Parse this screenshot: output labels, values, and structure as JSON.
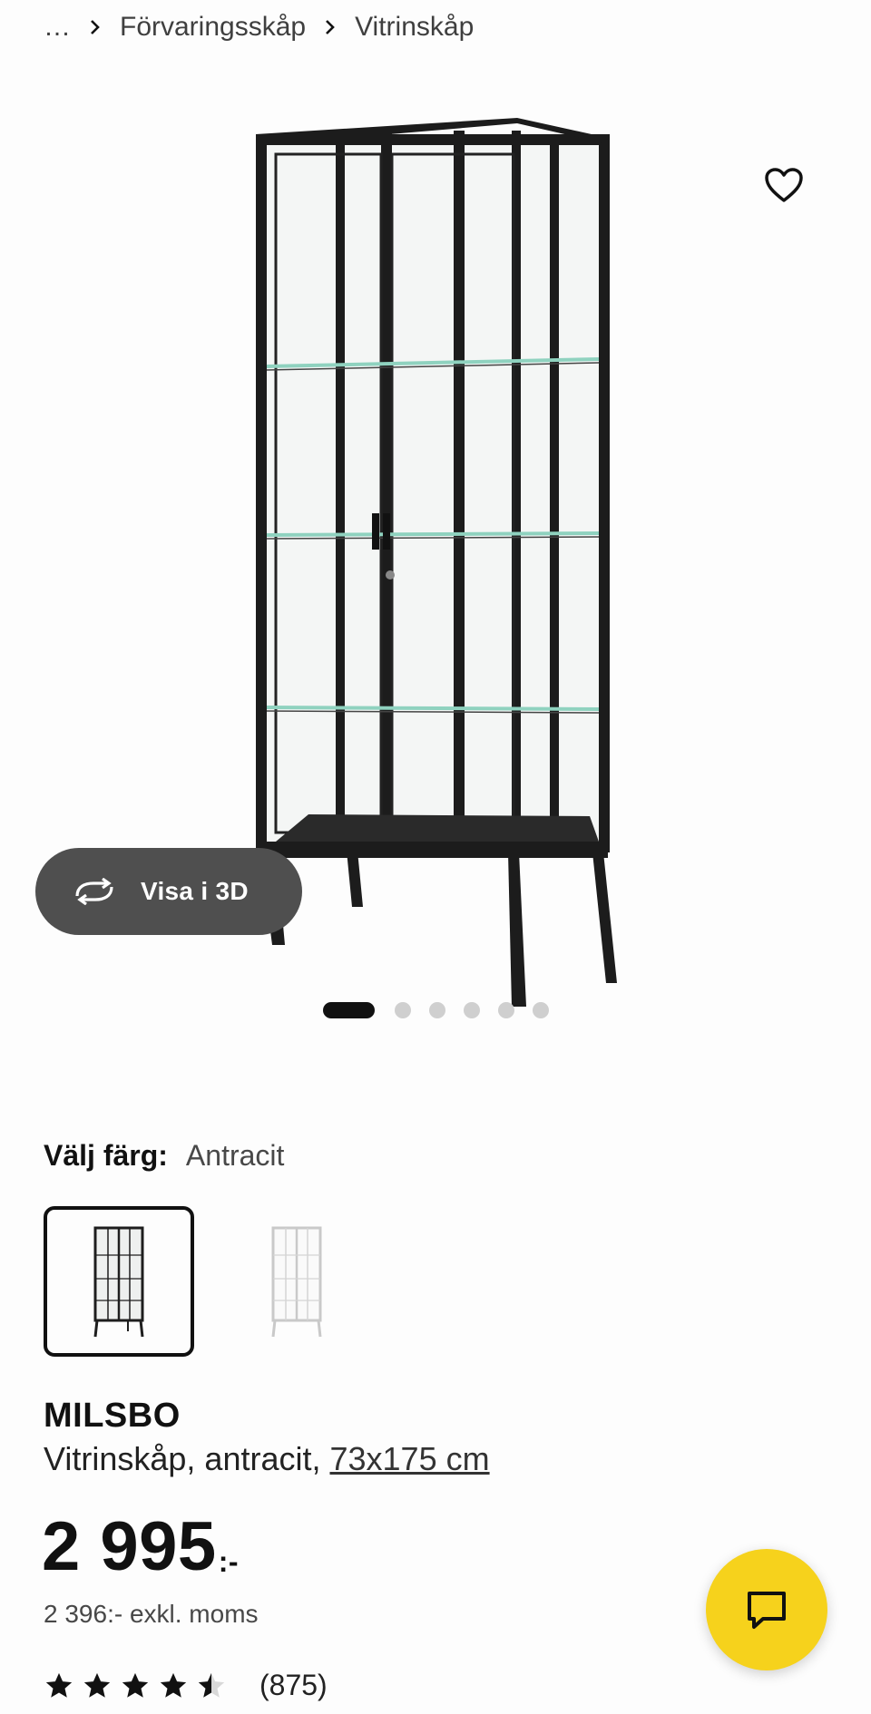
{
  "breadcrumb": {
    "ellipsis": "…",
    "items": [
      "Förvaringsskåp",
      "Vitrinskåp"
    ]
  },
  "gallery": {
    "view3d_label": "Visa i 3D",
    "image_count": 6,
    "active_image_index": 0
  },
  "color": {
    "label": "Välj färg:",
    "selected": "Antracit",
    "swatches": [
      "antracit",
      "vit"
    ]
  },
  "product": {
    "name": "MILSBO",
    "description": "Vitrinskåp, antracit, ",
    "dimensions": "73x175 cm",
    "price": "2 995",
    "price_suffix": ":-",
    "price_excl": "2 396:- exkl. moms",
    "rating": 4.5,
    "review_count": "(875)"
  },
  "icons": {
    "favorite": "heart-icon",
    "view3d": "rotate-3d-icon",
    "chat": "chat-bubble-icon",
    "separator": "chevron-right-icon"
  },
  "colors": {
    "accent_yellow": "#f6d21c",
    "pill_dark": "#4f4f4f",
    "dot_active": "#111111",
    "dot_inactive": "#cfcfcf"
  }
}
